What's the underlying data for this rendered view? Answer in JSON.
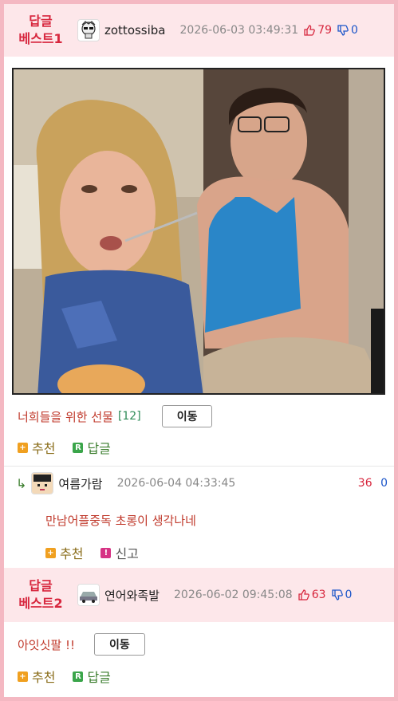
{
  "best1": {
    "label_line1": "답글",
    "label_line2": "베스트1",
    "nickname": "zottossiba",
    "date": "2026-06-03 03:49:31",
    "up": "79",
    "down": "0"
  },
  "post1": {
    "title": "너희들을 위한 선물",
    "reply_count": "[12]",
    "move_label": "이동",
    "recommend_label": "추천",
    "reply_label": "답글"
  },
  "comment": {
    "nickname": "여름가람",
    "date": "2026-06-04 04:33:45",
    "up": "36",
    "down": "0",
    "body": "만남어플중독 초롱이 생각나네",
    "recommend_label": "추천",
    "report_label": "신고"
  },
  "best2": {
    "label_line1": "답글",
    "label_line2": "베스트2",
    "nickname": "연어와족발",
    "date": "2026-06-02 09:45:08",
    "up": "63",
    "down": "0"
  },
  "post2": {
    "title": "아잇싯팔 !!",
    "move_label": "이동",
    "recommend_label": "추천",
    "reply_label": "답글"
  },
  "colors": {
    "border": "#f4b8c2",
    "header_bg": "#fde7ea",
    "accent_red": "#d7263d",
    "down_blue": "#1b55c9"
  }
}
